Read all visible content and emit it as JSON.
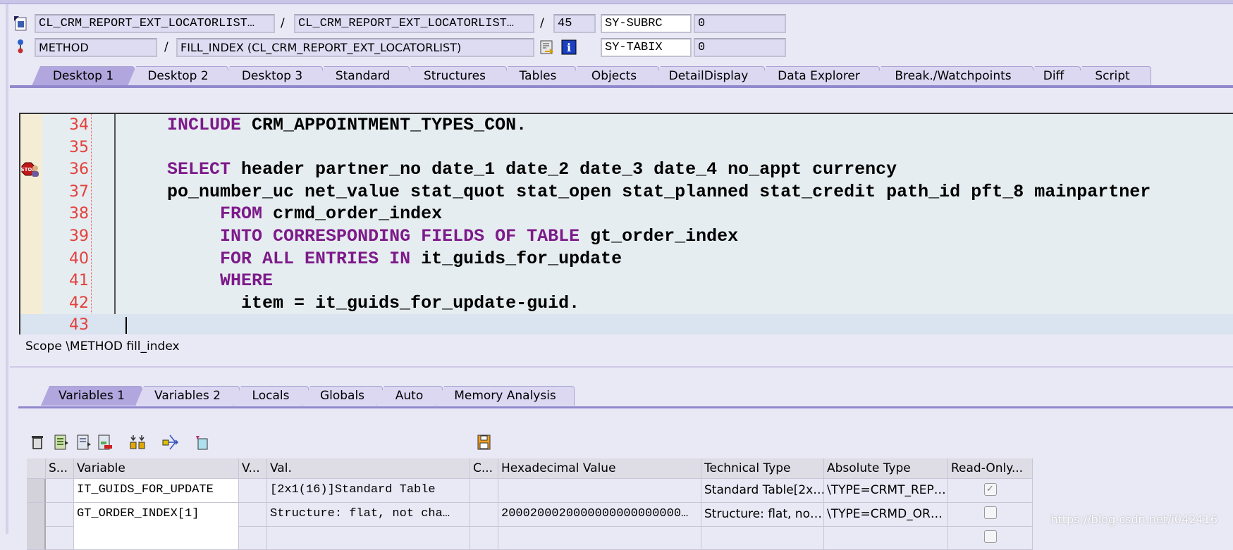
{
  "header": {
    "row1": {
      "program": "CL_CRM_REPORT_EXT_LOCATORLIST…",
      "include": "CL_CRM_REPORT_EXT_LOCATORLIST…",
      "line": "45",
      "sysvar": "SY-SUBRC",
      "sysval": "0"
    },
    "row2": {
      "event_type": "METHOD",
      "event": "FILL_INDEX (CL_CRM_REPORT_EXT_LOCATORLIST)",
      "sysvar": "SY-TABIX",
      "sysval": "0"
    },
    "separator": "/"
  },
  "tabs": [
    "Desktop 1",
    "Desktop 2",
    "Desktop 3",
    "Standard",
    "Structures",
    "Tables",
    "Objects",
    "DetailDisplay",
    "Data Explorer",
    "Break./Watchpoints",
    "Diff",
    "Script"
  ],
  "active_tab": "Desktop 1",
  "editor": {
    "breakpoint_line": 36,
    "current_line": 43,
    "lines": [
      {
        "n": "34",
        "tokens": [
          {
            "t": "  "
          },
          {
            "t": "INCLUDE",
            "k": 1
          },
          {
            "t": " CRM_APPOINTMENT_TYPES_CON."
          }
        ]
      },
      {
        "n": "35",
        "tokens": []
      },
      {
        "n": "36",
        "tokens": [
          {
            "t": "  "
          },
          {
            "t": "SELECT",
            "k": 1
          },
          {
            "t": " header partner_no date_1 date_2 date_3 date_4 no_appt currency"
          }
        ]
      },
      {
        "n": "37",
        "tokens": [
          {
            "t": "  po_number_uc net_value stat_quot stat_open stat_planned stat_credit path_id pft_8 mainpartner"
          }
        ]
      },
      {
        "n": "38",
        "tokens": [
          {
            "t": "       "
          },
          {
            "t": "FROM",
            "k": 1
          },
          {
            "t": " crmd_order_index"
          }
        ]
      },
      {
        "n": "39",
        "tokens": [
          {
            "t": "       "
          },
          {
            "t": "INTO CORRESPONDING FIELDS OF TABLE",
            "k": 1
          },
          {
            "t": " gt_order_index"
          }
        ]
      },
      {
        "n": "40",
        "tokens": [
          {
            "t": "       "
          },
          {
            "t": "FOR ALL ENTRIES IN",
            "k": 1
          },
          {
            "t": " it_guids_for_update"
          }
        ]
      },
      {
        "n": "41",
        "tokens": [
          {
            "t": "       "
          },
          {
            "t": "WHERE",
            "k": 1
          }
        ]
      },
      {
        "n": "42",
        "tokens": [
          {
            "t": "         item = it_guids_for_update-guid."
          }
        ]
      },
      {
        "n": "43",
        "tokens": []
      }
    ]
  },
  "scope": "Scope \\METHOD fill_index",
  "lower_tabs": [
    "Variables 1",
    "Variables 2",
    "Locals",
    "Globals",
    "Auto",
    "Memory Analysis"
  ],
  "active_lower_tab": "Variables 1",
  "toolbar_icons": [
    "delete-icon",
    "insert-row-icon",
    "append-row-icon",
    "delete-row-icon",
    "sort-icon",
    "navigate-icon",
    "new-tool-icon",
    "save-icon"
  ],
  "variables_table": {
    "columns": [
      "S...",
      "Variable",
      "V...",
      "Val.",
      "C...",
      "Hexadecimal Value",
      "Technical Type",
      "Absolute Type",
      "Read-Only..."
    ],
    "rows": [
      {
        "variable": "IT_GUIDS_FOR_UPDATE",
        "value": "[2x1(16)]Standard Table",
        "hex": "",
        "tech": "Standard Table[2x…",
        "abs": "\\TYPE=CRMT_REP…",
        "readonly": true
      },
      {
        "variable": "GT_ORDER_INDEX[1]",
        "value": "Structure: flat, not cha…",
        "hex": "2000200020000000000000000…",
        "tech": "Structure: flat, no…",
        "abs": "\\TYPE=CRMD_OR…",
        "readonly": false
      }
    ]
  },
  "watermark": "https://blog.csdn.net/i042416",
  "colors": {
    "keyword": "#7d1a8a",
    "line_number": "#e3403c",
    "active_tab": "#b1a7de",
    "tab": "#dcd8f2",
    "editor_bg": "#e6edf0"
  }
}
